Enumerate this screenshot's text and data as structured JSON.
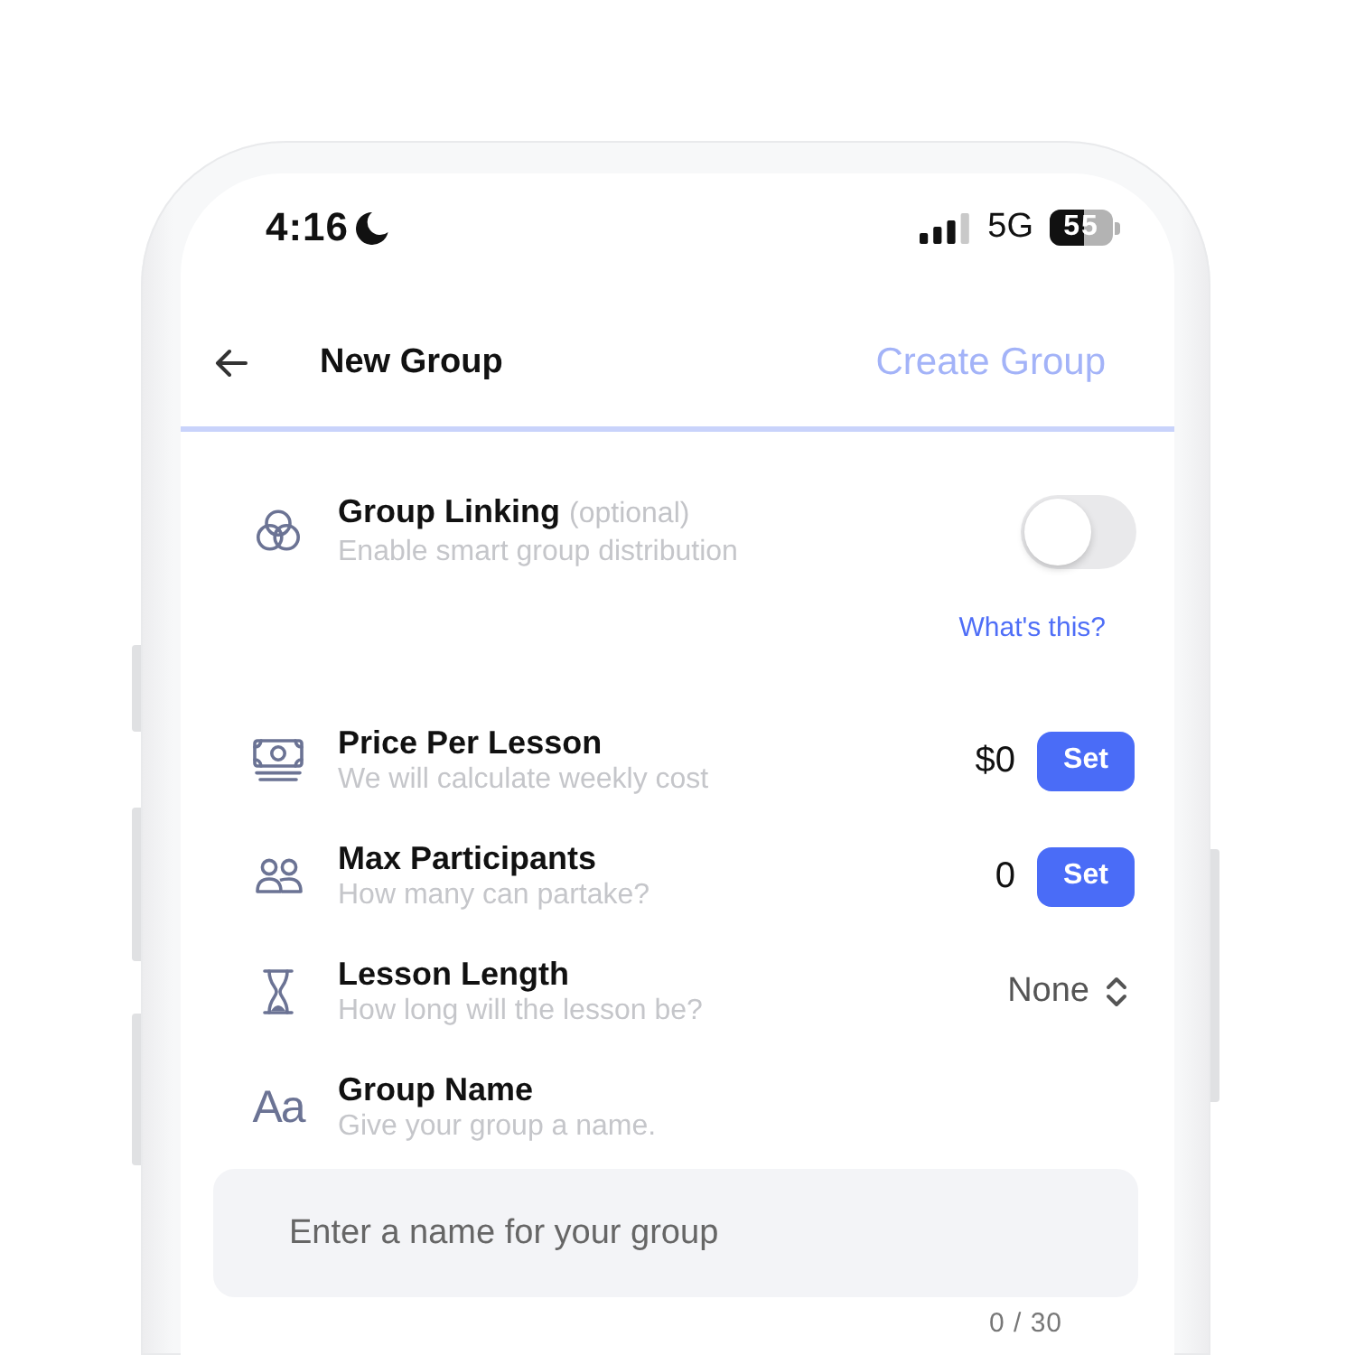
{
  "status_bar": {
    "time": "4:16",
    "network": "5G",
    "battery": {
      "text": "55",
      "level": 0.55
    }
  },
  "header": {
    "title": "New Group",
    "action": {
      "label": "Create Group",
      "disabled": true
    }
  },
  "settings": [
    {
      "kind": "toggle",
      "title": "Group Linking",
      "note": "(optional)",
      "subtitle": "Enable smart group distribution",
      "on": false,
      "link": "What's this?"
    },
    {
      "kind": "value",
      "title": "Price Per Lesson",
      "subtitle": "We will calculate weekly cost",
      "value": "$0",
      "button": "Set"
    },
    {
      "kind": "value",
      "title": "Max Participants",
      "subtitle": "How many can partake?",
      "value": "0",
      "button": "Set"
    },
    {
      "kind": "picker",
      "title": "Lesson Length",
      "subtitle": "How long will the lesson be?",
      "value": "None"
    },
    {
      "kind": "text",
      "icon_text": "Aa",
      "title": "Group Name",
      "subtitle": "Give your group a name.",
      "placeholder": "Enter a name for your group",
      "counter": "0 / 30"
    }
  ]
}
